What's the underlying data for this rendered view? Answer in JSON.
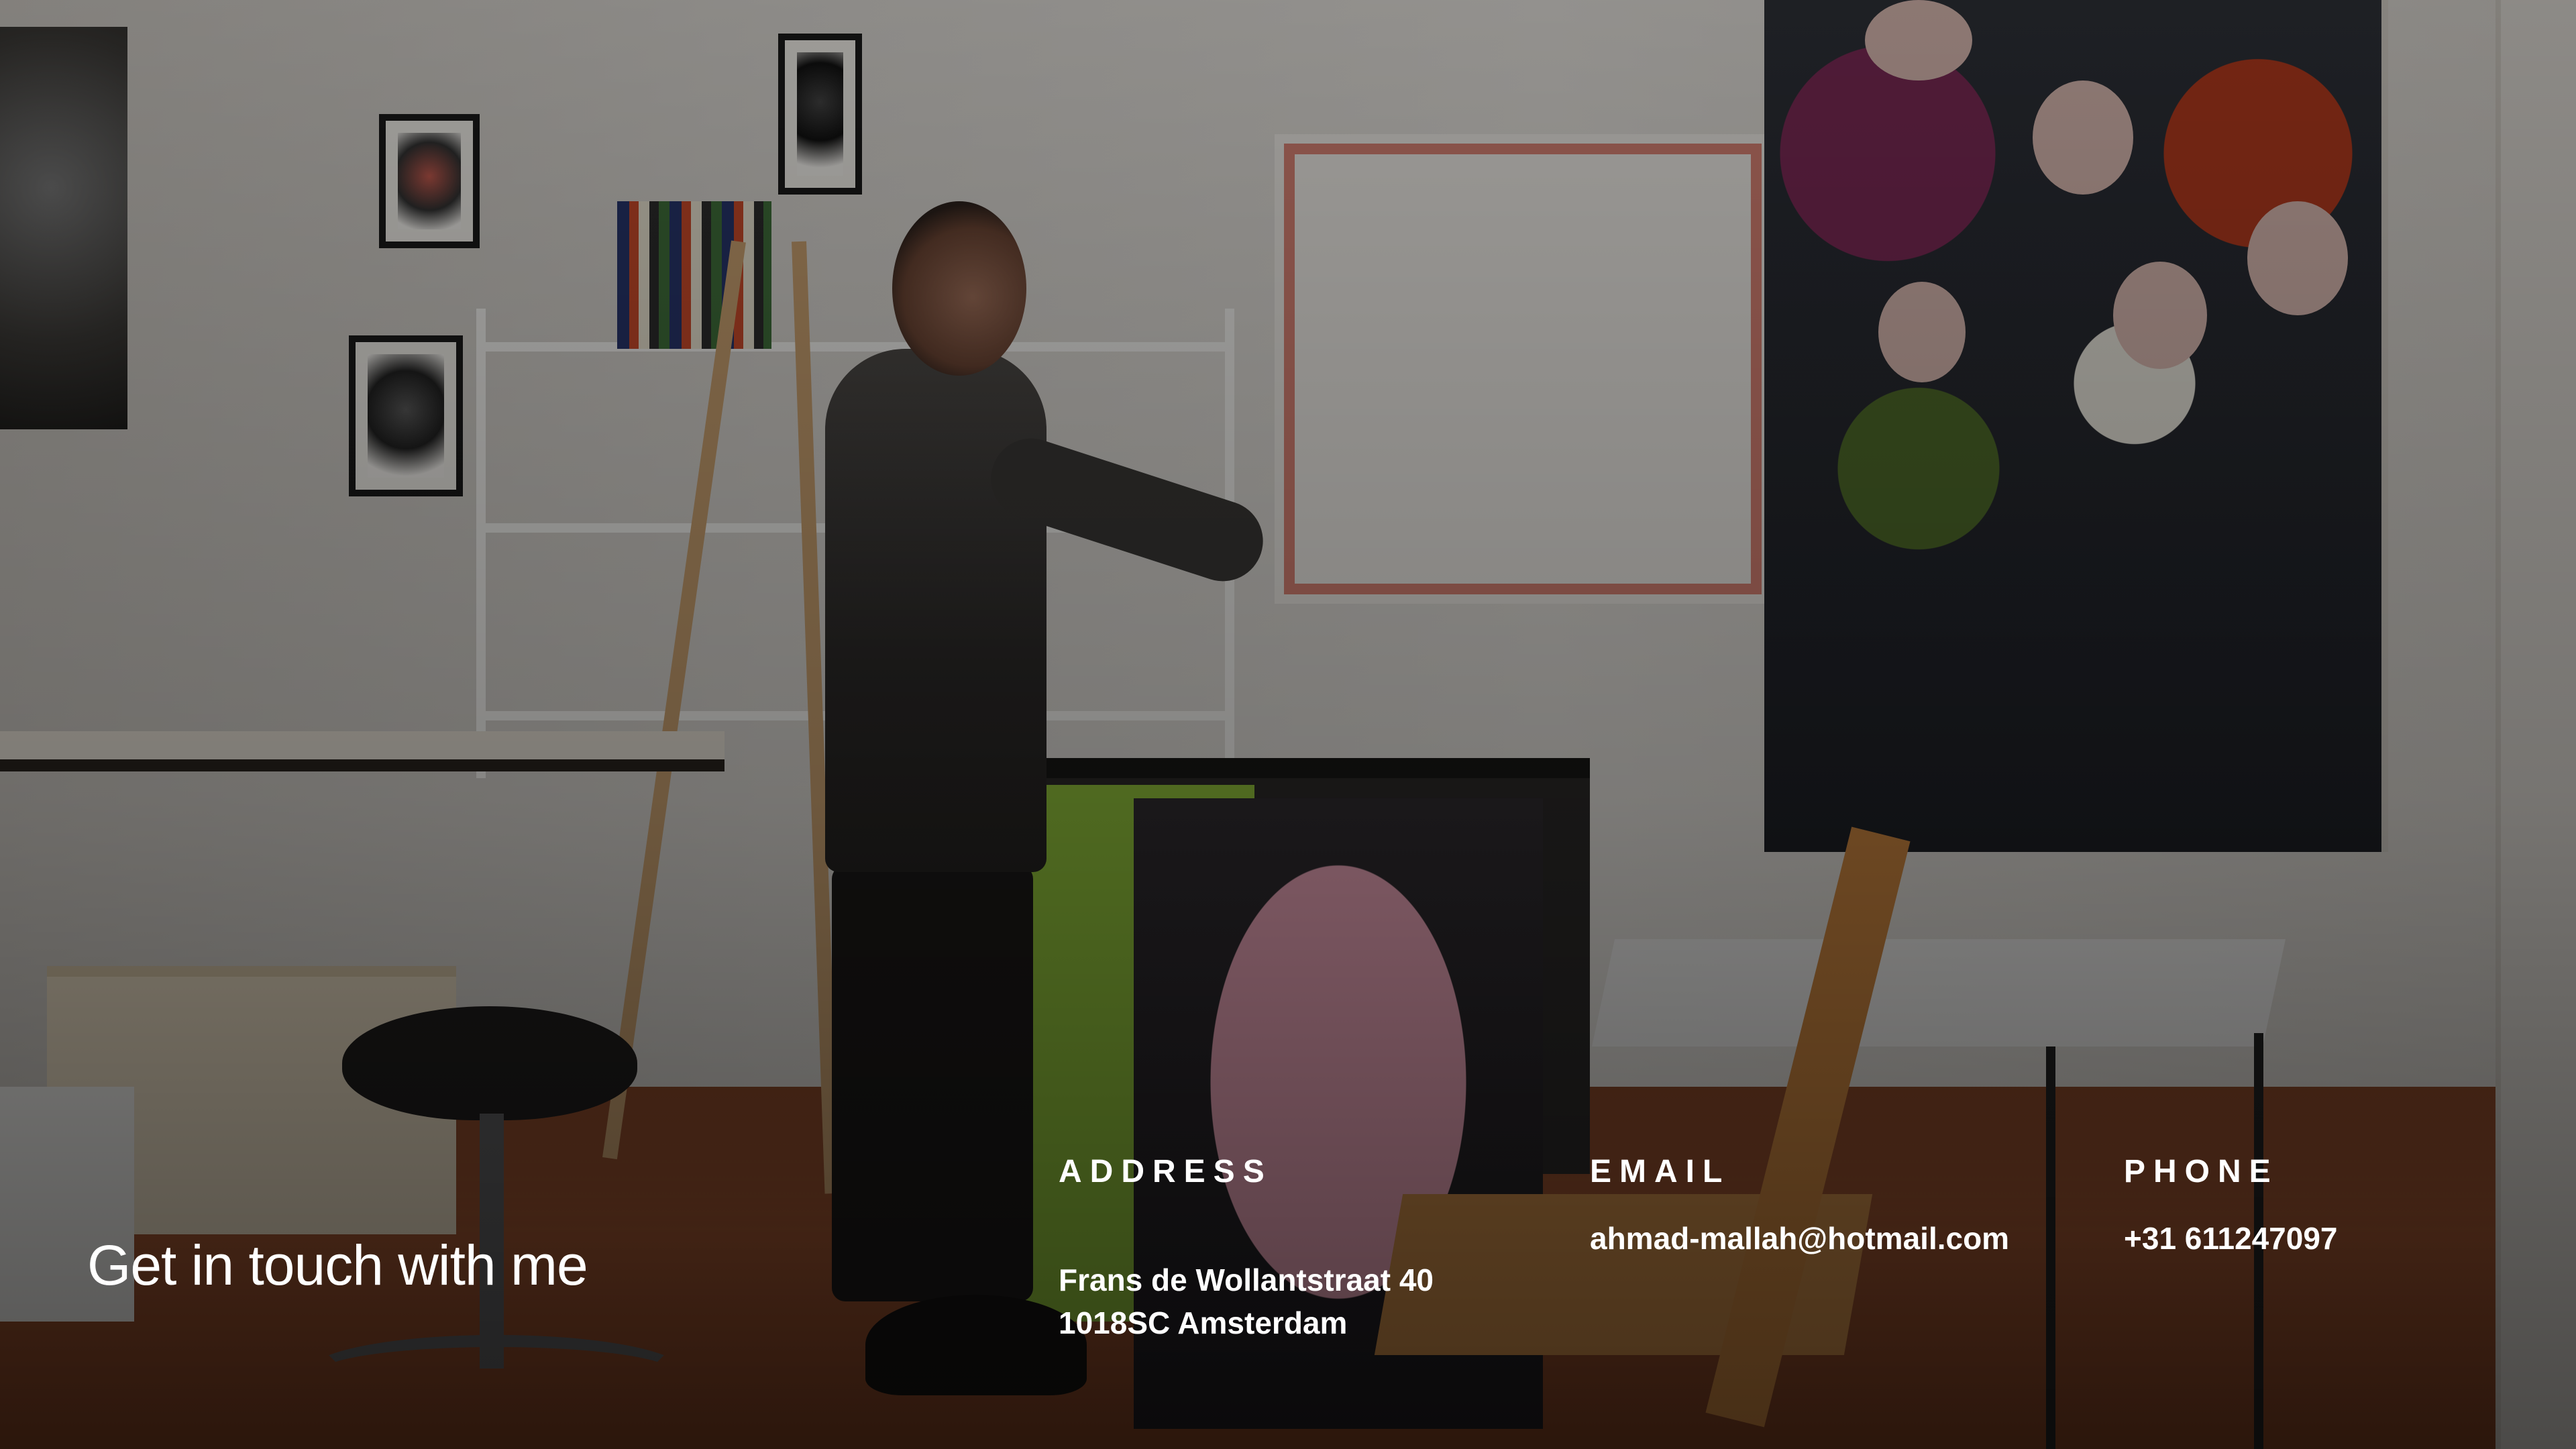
{
  "contact": {
    "headline": "Get in touch with me",
    "address": {
      "label": "ADDRESS",
      "line1": "Frans de Wollantstraat 40",
      "line2": "1018SC Amsterdam"
    },
    "email": {
      "label": "EMAIL",
      "value": "ahmad-mallah@hotmail.com"
    },
    "phone": {
      "label": "PHONE",
      "value": "+31 611247097"
    }
  },
  "background": {
    "description_icon": "studio-photo",
    "overlay_color": "#000000"
  }
}
